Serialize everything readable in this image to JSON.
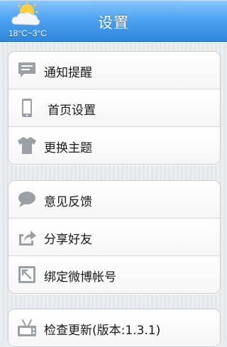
{
  "header": {
    "title": "设置",
    "weather": {
      "icon": "partly-cloudy-icon",
      "temperature": "18°C~3°C"
    }
  },
  "groups": [
    {
      "items": [
        {
          "label": "通知提醒",
          "icon": "message-icon"
        },
        {
          "label": "首页设置",
          "icon": "phone-icon"
        },
        {
          "label": "更换主题",
          "icon": "shirt-icon"
        }
      ]
    },
    {
      "items": [
        {
          "label": "意见反馈",
          "icon": "speech-bubble-icon"
        },
        {
          "label": "分享好友",
          "icon": "share-icon"
        },
        {
          "label": "绑定微博帐号",
          "icon": "link-account-icon"
        }
      ]
    },
    {
      "items": [
        {
          "label": "检查更新(版本:1.3.1)",
          "icon": "tv-update-icon"
        }
      ]
    }
  ],
  "colors": {
    "header_top": "#8ec8ff",
    "header_bottom": "#2f86dc",
    "icon_gray": "#8a8f94"
  }
}
